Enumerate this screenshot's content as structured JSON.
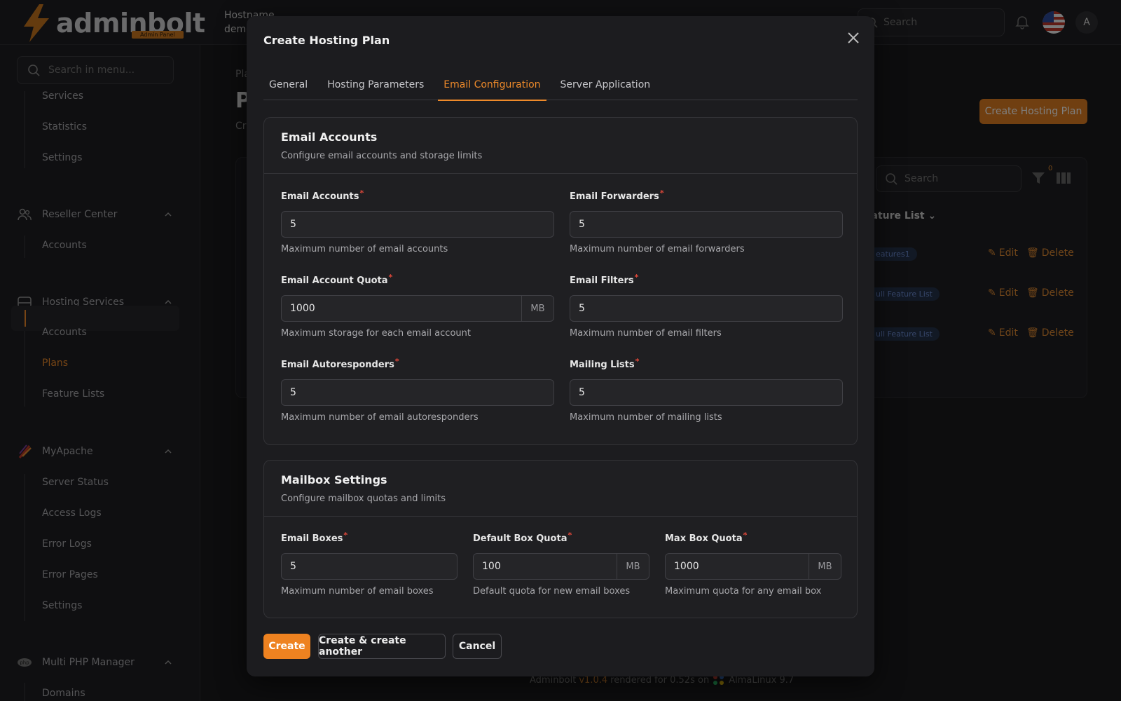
{
  "app": {
    "logo_text": "adminbolt",
    "logo_sub": "Admin Panel",
    "hostname_label": "Hostname",
    "hostname_value": "demo",
    "search_placeholder": "Search",
    "avatar_initial": "A"
  },
  "sidebar": {
    "search_placeholder": "Search in menu...",
    "items_top": [
      "Services",
      "Statistics",
      "Settings"
    ],
    "groups": [
      {
        "label": "Reseller Center",
        "icon": "users-icon",
        "items": [
          "Accounts"
        ]
      },
      {
        "label": "Hosting Services",
        "icon": "server-icon",
        "items": [
          "Accounts",
          "Plans",
          "Feature Lists"
        ],
        "active": "Plans"
      },
      {
        "label": "MyApache",
        "icon": "feather-icon",
        "items": [
          "Server Status",
          "Access Logs",
          "Error Logs",
          "Error Pages",
          "Settings"
        ]
      },
      {
        "label": "Multi PHP Manager",
        "icon": "php-icon",
        "items": [
          "Domains"
        ]
      }
    ]
  },
  "background": {
    "breadcrumb": "Pla",
    "title": "P",
    "subtitle": "Cr",
    "create_button": "Create Hosting Plan",
    "table_search_placeholder": "Search",
    "filter_count": "0",
    "column_header": "eature List",
    "rows": [
      {
        "badge": "eatures1",
        "edit": "Edit",
        "delete": "Delete"
      },
      {
        "badge": "ull Feature List",
        "edit": "Edit",
        "delete": "Delete"
      },
      {
        "badge": "ull Feature List",
        "edit": "Edit",
        "delete": "Delete"
      }
    ],
    "footer": {
      "brand": "Adminbolt",
      "version": "v1.0.4",
      "rendered": "rendered for 0.52s on",
      "os": "AlmaLinux 9.7"
    }
  },
  "modal": {
    "title": "Create Hosting Plan",
    "tabs": [
      "General",
      "Hosting Parameters",
      "Email Configuration",
      "Server Application"
    ],
    "active_tab": "Email Configuration",
    "email_accounts_section": {
      "title": "Email Accounts",
      "description": "Configure email accounts and storage limits",
      "fields": {
        "email_accounts": {
          "label": "Email Accounts",
          "value": "5",
          "help": "Maximum number of email accounts"
        },
        "email_forwarders": {
          "label": "Email Forwarders",
          "value": "5",
          "help": "Maximum number of email forwarders"
        },
        "email_account_quota": {
          "label": "Email Account Quota",
          "value": "1000",
          "unit": "MB",
          "help": "Maximum storage for each email account"
        },
        "email_filters": {
          "label": "Email Filters",
          "value": "5",
          "help": "Maximum number of email filters"
        },
        "email_autoresponders": {
          "label": "Email Autoresponders",
          "value": "5",
          "help": "Maximum number of email autoresponders"
        },
        "mailing_lists": {
          "label": "Mailing Lists",
          "value": "5",
          "help": "Maximum number of mailing lists"
        }
      }
    },
    "mailbox_section": {
      "title": "Mailbox Settings",
      "description": "Configure mailbox quotas and limits",
      "fields": {
        "email_boxes": {
          "label": "Email Boxes",
          "value": "5",
          "help": "Maximum number of email boxes"
        },
        "default_box_quota": {
          "label": "Default Box Quota",
          "value": "100",
          "unit": "MB",
          "help": "Default quota for new email boxes"
        },
        "max_box_quota": {
          "label": "Max Box Quota",
          "value": "1000",
          "unit": "MB",
          "help": "Maximum quota for any email box"
        }
      }
    },
    "buttons": {
      "create": "Create",
      "create_another": "Create & create another",
      "cancel": "Cancel"
    }
  },
  "colors": {
    "accent": "#ee8a2a",
    "background": "#1b1b1d",
    "required": "#e0483a"
  }
}
